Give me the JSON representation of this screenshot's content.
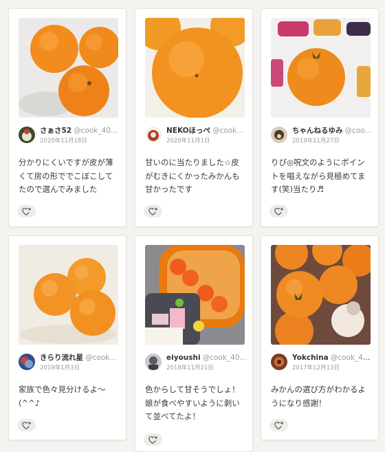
{
  "cards": [
    {
      "user_name": "さぁさ52",
      "user_id": "@cook_40...",
      "date": "2020年11月18日",
      "text": "分かりにくいですが皮が薄くて房の形ででこぼこしてたので選んでみました",
      "photo_icon": "mandarin-photo",
      "avatar_icon": "avatar-icon"
    },
    {
      "user_name": "NEKOほっぺ",
      "user_id": "@cook...",
      "date": "2020年11月1日",
      "text": "甘いのに当たりました☆皮がむきにくかったみかんも甘かったです",
      "photo_icon": "mandarin-photo",
      "avatar_icon": "avatar-icon"
    },
    {
      "user_name": "ちゃんねるゆみ",
      "user_id": "@coo...",
      "date": "2019年11月27日",
      "text": "りぴ◎呪文のようにポイントを唱えながら見極めてます(笑)当たり♬",
      "photo_icon": "mandarin-photo",
      "avatar_icon": "avatar-icon"
    },
    {
      "user_name": "きらり流れ星",
      "user_id": "@cook...",
      "date": "2019年1月3日",
      "text": "家族で色々見分けるよ〜(^^♪",
      "photo_icon": "mandarin-photo",
      "avatar_icon": "avatar-icon"
    },
    {
      "user_name": "eiyoushi",
      "user_id": "@cook_40...",
      "date": "2018年11月21日",
      "text": "色からして甘そうでしょ！娘が食べやすいように剥いて並べてたよ！",
      "photo_icon": "mandarin-bento-photo",
      "avatar_icon": "avatar-icon"
    },
    {
      "user_name": "Yokchina",
      "user_id": "@cook_40...",
      "date": "2017年12月13日",
      "text": "みかんの選び方がわかるようになり感謝！",
      "photo_icon": "mandarin-photo",
      "avatar_icon": "avatar-icon"
    }
  ],
  "like_icon": "heart-plus-icon",
  "colors": {
    "accent": "#f08a1c",
    "background": "#f4f3f0"
  }
}
